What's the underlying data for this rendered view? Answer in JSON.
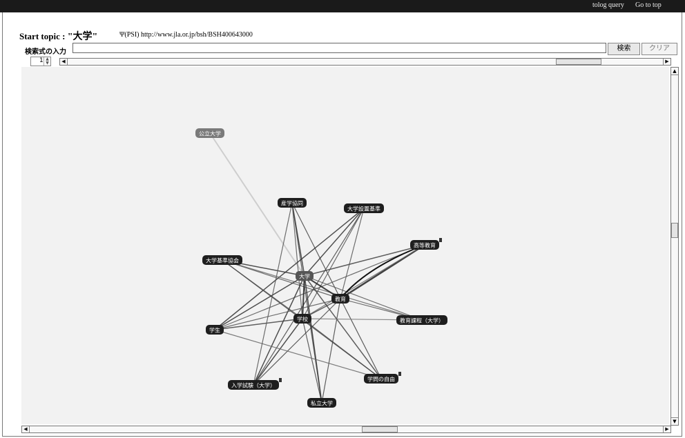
{
  "nav": {
    "tolog": "tolog query",
    "top": "Go to top"
  },
  "header": {
    "prefix": "Start topic : ",
    "topic": "\"大学\"",
    "psi": "Ψ(PSI)  http://www.jla.or.jp/bsh/BSH400643000"
  },
  "query": {
    "label": "検索式の入力",
    "value": "",
    "search_label": "検索",
    "clear_label": "クリア"
  },
  "depth": "1",
  "graph": {
    "nodes": [
      {
        "id": "koritsu",
        "label": "公立大学",
        "badge": false
      },
      {
        "id": "sangaku",
        "label": "産学協同",
        "badge": false
      },
      {
        "id": "secchi",
        "label": "大学設置基準",
        "badge": false
      },
      {
        "id": "koto",
        "label": "高等教育",
        "badge": true
      },
      {
        "id": "kijun",
        "label": "大学基準協会",
        "badge": false
      },
      {
        "id": "daigaku",
        "label": "大学",
        "badge": false
      },
      {
        "id": "kyoiku",
        "label": "教育",
        "badge": false
      },
      {
        "id": "gakko",
        "label": "学校",
        "badge": false
      },
      {
        "id": "katei",
        "label": "教育課程（大学）",
        "badge": false
      },
      {
        "id": "gakusei",
        "label": "学生",
        "badge": false
      },
      {
        "id": "jiyu",
        "label": "学問の自由",
        "badge": true
      },
      {
        "id": "nyushi",
        "label": "入学試験（大学）",
        "badge": true
      },
      {
        "id": "shiritsu",
        "label": "私立大学",
        "badge": false
      }
    ]
  }
}
